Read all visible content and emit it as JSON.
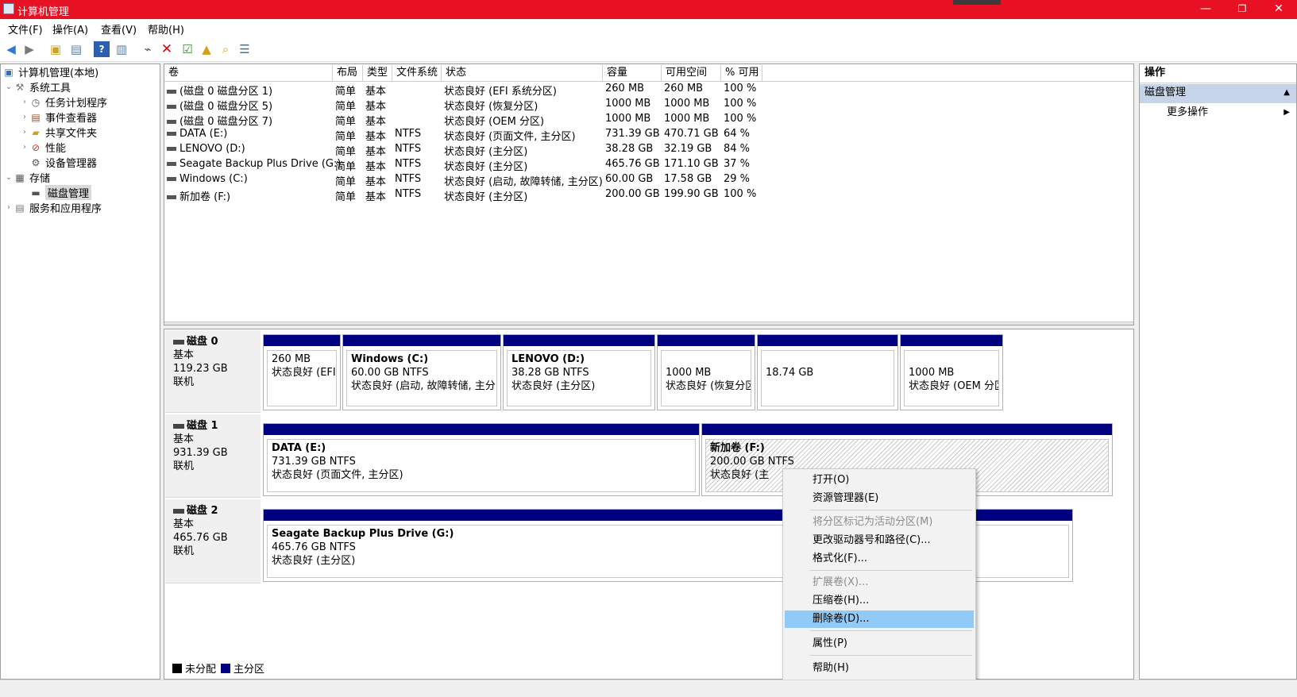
{
  "window": {
    "title": "计算机管理",
    "min_icon": "—",
    "max_icon": "❐",
    "close_icon": "✕"
  },
  "menu": [
    "文件(F)",
    "操作(A)",
    "查看(V)",
    "帮助(H)"
  ],
  "tree": {
    "root": "计算机管理(本地)",
    "system_tools": "系统工具",
    "task_scheduler": "任务计划程序",
    "event_viewer": "事件查看器",
    "shared_folders": "共享文件夹",
    "performance": "性能",
    "device_manager": "设备管理器",
    "storage": "存储",
    "disk_management": "磁盘管理",
    "services": "服务和应用程序"
  },
  "volumes": {
    "columns": [
      "卷",
      "布局",
      "类型",
      "文件系统",
      "状态",
      "容量",
      "可用空间",
      "% 可用"
    ],
    "rows": [
      [
        "(磁盘 0 磁盘分区 1)",
        "简单",
        "基本",
        "",
        "状态良好 (EFI 系统分区)",
        "260 MB",
        "260 MB",
        "100 %"
      ],
      [
        "(磁盘 0 磁盘分区 5)",
        "简单",
        "基本",
        "",
        "状态良好 (恢复分区)",
        "1000 MB",
        "1000 MB",
        "100 %"
      ],
      [
        "(磁盘 0 磁盘分区 7)",
        "简单",
        "基本",
        "",
        "状态良好 (OEM 分区)",
        "1000 MB",
        "1000 MB",
        "100 %"
      ],
      [
        "DATA (E:)",
        "简单",
        "基本",
        "NTFS",
        "状态良好 (页面文件, 主分区)",
        "731.39 GB",
        "470.71 GB",
        "64 %"
      ],
      [
        "LENOVO (D:)",
        "简单",
        "基本",
        "NTFS",
        "状态良好 (主分区)",
        "38.28 GB",
        "32.19 GB",
        "84 %"
      ],
      [
        "Seagate Backup Plus Drive (G:)",
        "简单",
        "基本",
        "NTFS",
        "状态良好 (主分区)",
        "465.76 GB",
        "171.10 GB",
        "37 %"
      ],
      [
        "Windows (C:)",
        "简单",
        "基本",
        "NTFS",
        "状态良好 (启动, 故障转储, 主分区)",
        "60.00 GB",
        "17.58 GB",
        "29 %"
      ],
      [
        "新加卷 (F:)",
        "简单",
        "基本",
        "NTFS",
        "状态良好 (主分区)",
        "200.00 GB",
        "199.90 GB",
        "100 %"
      ]
    ]
  },
  "disks": {
    "disk0": {
      "name": "磁盘 0",
      "type": "基本",
      "size": "119.23 GB",
      "status": "联机",
      "parts": [
        {
          "name": "",
          "size": "260 MB",
          "status": "状态良好 (EFI 系"
        },
        {
          "name": "Windows  (C:)",
          "size": "60.00 GB NTFS",
          "status": "状态良好 (启动, 故障转储, 主分区"
        },
        {
          "name": "LENOVO  (D:)",
          "size": "38.28 GB NTFS",
          "status": "状态良好 (主分区)"
        },
        {
          "name": "",
          "size": "1000 MB",
          "status": "状态良好 (恢复分区"
        },
        {
          "name": "",
          "size": "18.74 GB",
          "status": ""
        },
        {
          "name": "",
          "size": "1000 MB",
          "status": "状态良好 (OEM 分区"
        }
      ]
    },
    "disk1": {
      "name": "磁盘 1",
      "type": "基本",
      "size": "931.39 GB",
      "status": "联机",
      "parts": [
        {
          "name": "DATA  (E:)",
          "size": "731.39 GB NTFS",
          "status": "状态良好 (页面文件, 主分区)"
        },
        {
          "name": "新加卷  (F:)",
          "size": "200.00 GB NTFS",
          "status": "状态良好 (主"
        }
      ]
    },
    "disk2": {
      "name": "磁盘 2",
      "type": "基本",
      "size": "465.76 GB",
      "status": "联机",
      "parts": [
        {
          "name": "Seagate Backup Plus Drive  (G:)",
          "size": "465.76 GB NTFS",
          "status": "状态良好 (主分区)"
        }
      ]
    }
  },
  "legend": {
    "unallocated": "未分配",
    "primary": "主分区"
  },
  "actions": {
    "header": "操作",
    "section": "磁盘管理",
    "more": "更多操作"
  },
  "context_menu": {
    "open": "打开(O)",
    "explorer": "资源管理器(E)",
    "mark_active": "将分区标记为活动分区(M)",
    "change_letter": "更改驱动器号和路径(C)...",
    "format": "格式化(F)...",
    "extend": "扩展卷(X)...",
    "shrink": "压缩卷(H)...",
    "delete": "删除卷(D)...",
    "properties": "属性(P)",
    "help": "帮助(H)"
  },
  "colors": {
    "titlebar": "#e81123",
    "primary_partition": "#000080",
    "highlight": "#91c9f7"
  }
}
